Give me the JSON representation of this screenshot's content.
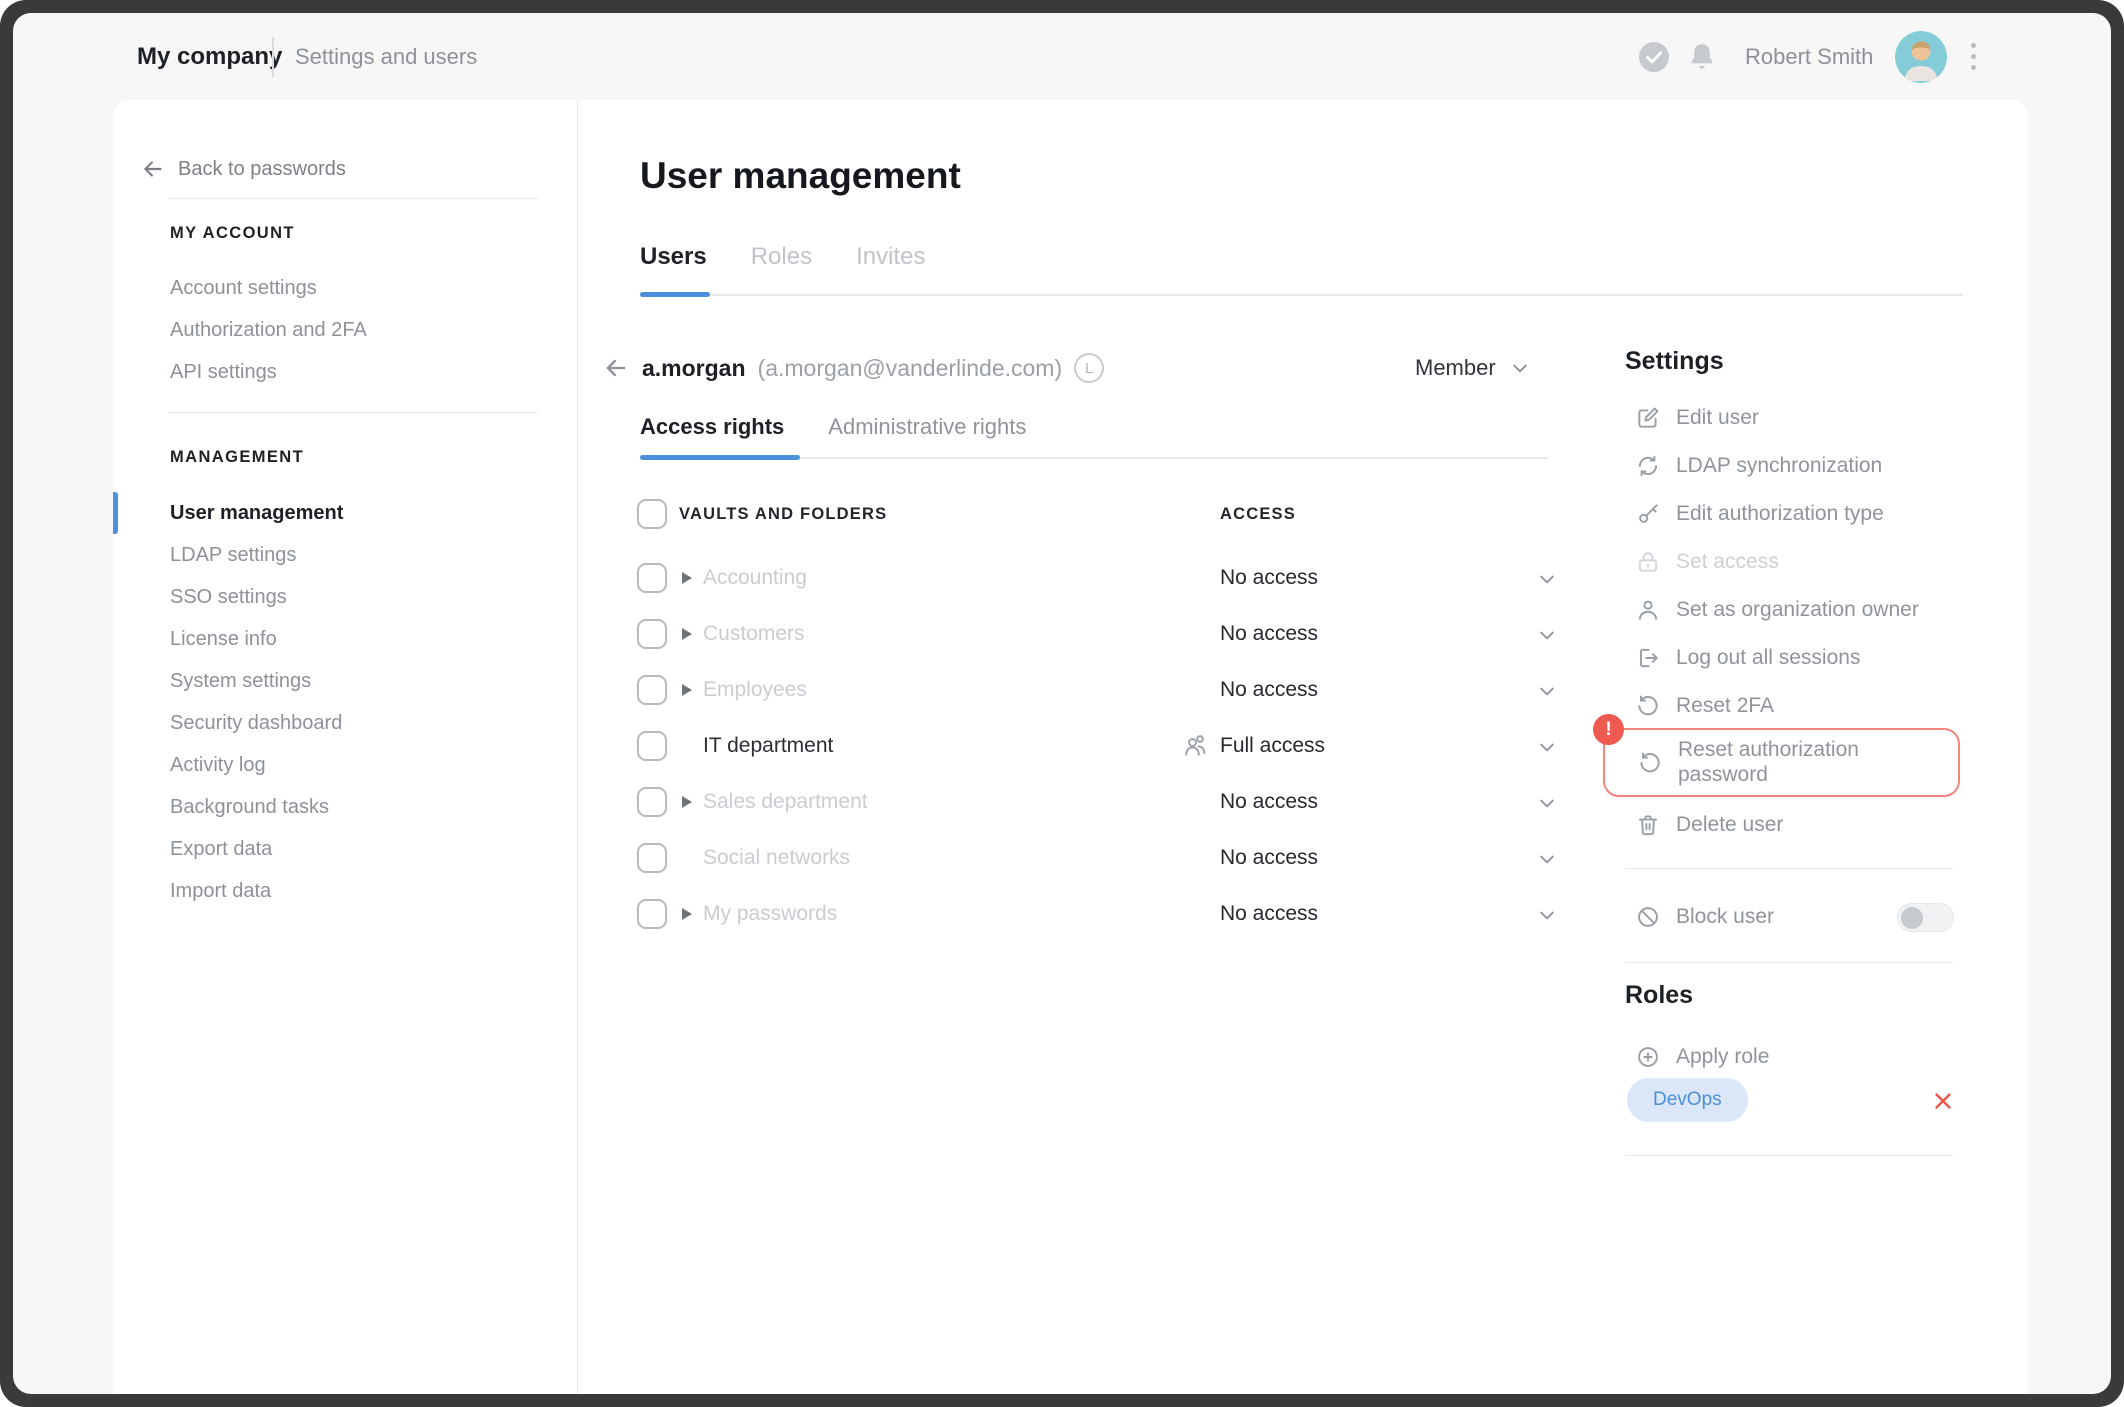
{
  "topbar": {
    "company": "My company",
    "section": "Settings and users",
    "user_name": "Robert Smith"
  },
  "sidebar": {
    "back_label": "Back to passwords",
    "my_account": {
      "title": "MY ACCOUNT",
      "items": [
        {
          "label": "Account settings"
        },
        {
          "label": "Authorization and 2FA"
        },
        {
          "label": "API settings"
        }
      ]
    },
    "management": {
      "title": "MANAGEMENT",
      "items": [
        {
          "label": "User management",
          "active": true
        },
        {
          "label": "LDAP settings"
        },
        {
          "label": "SSO settings"
        },
        {
          "label": "License info"
        },
        {
          "label": "System settings"
        },
        {
          "label": "Security dashboard"
        },
        {
          "label": "Activity log"
        },
        {
          "label": "Background tasks"
        },
        {
          "label": "Export data"
        },
        {
          "label": "Import data"
        }
      ]
    }
  },
  "main": {
    "title": "User management",
    "tabs": [
      {
        "label": "Users",
        "active": true
      },
      {
        "label": "Roles",
        "active": false
      },
      {
        "label": "Invites",
        "active": false
      }
    ],
    "user": {
      "name": "a.morgan",
      "email": "(a.morgan@vanderlinde.com)",
      "badge_letter": "L",
      "role_value": "Member"
    },
    "subtabs": [
      {
        "label": "Access rights",
        "active": true
      },
      {
        "label": "Administrative rights",
        "active": false
      }
    ],
    "table": {
      "columns": {
        "vaults": "VAULTS AND FOLDERS",
        "access": "ACCESS"
      },
      "rows": [
        {
          "name": "Accounting",
          "access": "No access",
          "expandable": true,
          "muted": true
        },
        {
          "name": "Customers",
          "access": "No access",
          "expandable": true,
          "muted": true
        },
        {
          "name": "Employees",
          "access": "No access",
          "expandable": true,
          "muted": true
        },
        {
          "name": "IT department",
          "access": "Full access",
          "expandable": false,
          "muted": false,
          "access_icon": "people-icon"
        },
        {
          "name": "Sales department",
          "access": "No access",
          "expandable": true,
          "muted": true
        },
        {
          "name": "Social networks",
          "access": "No access",
          "expandable": false,
          "muted": true
        },
        {
          "name": "My passwords",
          "access": "No access",
          "expandable": true,
          "muted": true
        }
      ]
    }
  },
  "settings_panel": {
    "title": "Settings",
    "items": [
      {
        "label": "Edit user",
        "icon": "edit-icon"
      },
      {
        "label": "LDAP synchronization",
        "icon": "sync-icon"
      },
      {
        "label": "Edit authorization type",
        "icon": "key-icon"
      },
      {
        "label": "Set access",
        "icon": "lock-icon",
        "disabled": true
      },
      {
        "label": "Set as organization owner",
        "icon": "person-icon"
      },
      {
        "label": "Log out all sessions",
        "icon": "logout-icon"
      },
      {
        "label": "Reset 2FA",
        "icon": "reset-icon"
      },
      {
        "label": "Reset authorization password",
        "icon": "reset-icon",
        "highlighted": true,
        "alert_badge": "!"
      },
      {
        "label": "Delete user",
        "icon": "trash-icon"
      }
    ],
    "block_user": {
      "label": "Block user",
      "icon": "block-icon",
      "enabled": false
    },
    "roles": {
      "title": "Roles",
      "apply_label": "Apply role",
      "chips": [
        {
          "label": "DevOps"
        }
      ]
    }
  },
  "colors": {
    "accent_blue": "#4a90dd",
    "danger_red": "#ee5a50",
    "highlight_border": "#f2857d",
    "chip_bg": "#dbe7f8",
    "chip_text": "#4a90d9"
  }
}
